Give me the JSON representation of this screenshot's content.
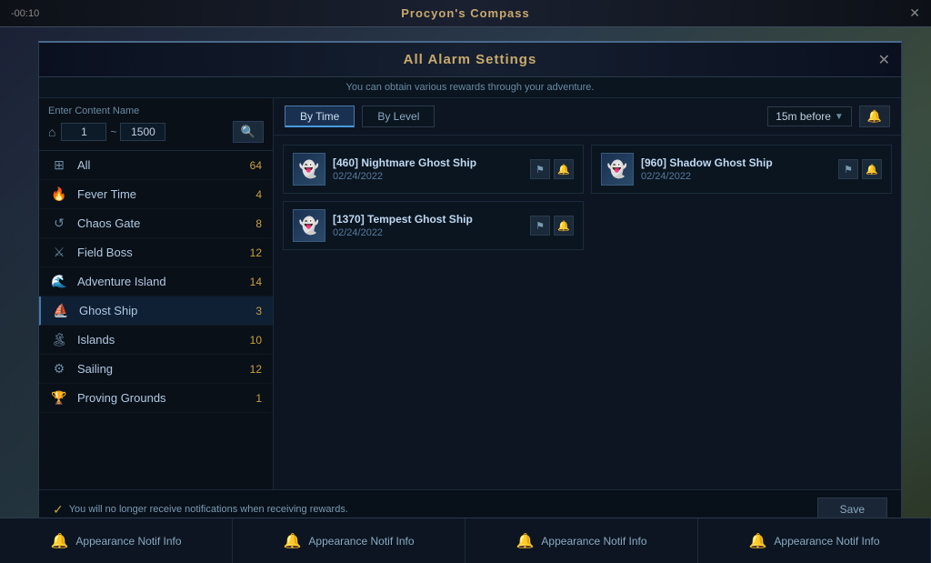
{
  "window": {
    "title": "Procyon's Compass",
    "close_label": "✕",
    "time": "-00:10"
  },
  "modal": {
    "title": "All Alarm Settings",
    "subtitle": "You can obtain various rewards through your adventure.",
    "close_label": "✕",
    "decorator_line": "◆"
  },
  "search": {
    "label": "Enter Content Name",
    "min_value": "1",
    "max_value": "1500",
    "separator": "~",
    "house_icon": "⌂",
    "search_icon": "🔍"
  },
  "categories": [
    {
      "id": "all",
      "icon": "⊞",
      "name": "All",
      "count": "64"
    },
    {
      "id": "fever",
      "icon": "🔥",
      "name": "Fever Time",
      "count": "4"
    },
    {
      "id": "chaos",
      "icon": "↺",
      "name": "Chaos Gate",
      "count": "8"
    },
    {
      "id": "field-boss",
      "icon": "⚔",
      "name": "Field Boss",
      "count": "12"
    },
    {
      "id": "adventure",
      "icon": "🌊",
      "name": "Adventure Island",
      "count": "14"
    },
    {
      "id": "ghost-ship",
      "icon": "⛵",
      "name": "Ghost Ship",
      "count": "3",
      "active": true
    },
    {
      "id": "islands",
      "icon": "🏝",
      "name": "Islands",
      "count": "10"
    },
    {
      "id": "sailing",
      "icon": "⚙",
      "name": "Sailing",
      "count": "12"
    },
    {
      "id": "proving",
      "icon": "🏆",
      "name": "Proving Grounds",
      "count": "1"
    }
  ],
  "tabs": [
    {
      "id": "by-time",
      "label": "By Time",
      "active": true
    },
    {
      "id": "by-level",
      "label": "By Level",
      "active": false
    }
  ],
  "time_dropdown": {
    "value": "15m before",
    "arrow": "▼",
    "sound_icon": "🔔"
  },
  "alarm_items": [
    {
      "id": 1,
      "name": "[460] Nightmare Ghost Ship",
      "date": "02/24/2022",
      "icon": "👻"
    },
    {
      "id": 2,
      "name": "[960] Shadow Ghost Ship",
      "date": "02/24/2022",
      "icon": "👻"
    },
    {
      "id": 3,
      "name": "[1370] Tempest Ghost Ship",
      "date": "02/24/2022",
      "icon": "👻"
    }
  ],
  "action_icons": {
    "flag": "⚑",
    "sound": "🔔"
  },
  "footer": {
    "check_icon": "✓",
    "notice": "You will no longer receive notifications when receiving rewards.",
    "save_label": "Save"
  },
  "bottom_buttons": [
    {
      "id": 1,
      "icon": "🔔",
      "label": "Appearance Notif Info"
    },
    {
      "id": 2,
      "icon": "🔔",
      "label": "Appearance Notif Info"
    },
    {
      "id": 3,
      "icon": "🔔",
      "label": "Appearance Notif Info"
    },
    {
      "id": 4,
      "icon": "🔔",
      "label": "Appearance Notif Info"
    }
  ]
}
